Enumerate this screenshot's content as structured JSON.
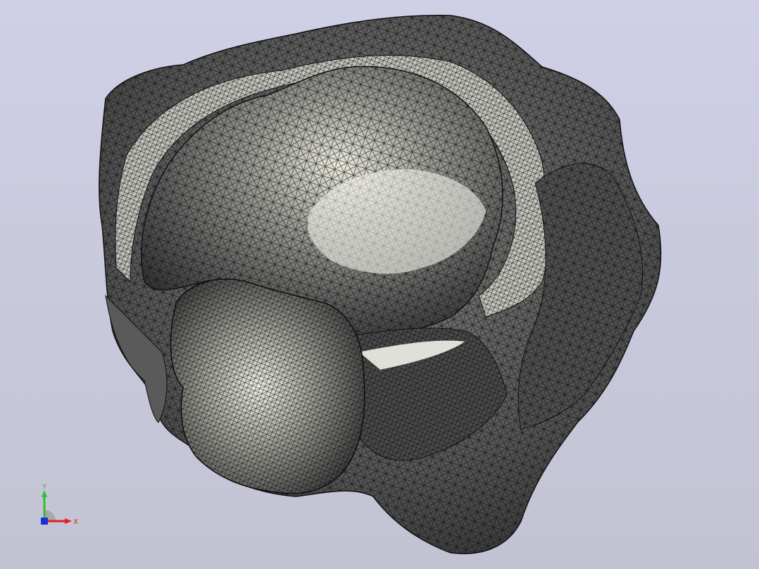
{
  "viewport": {
    "background_top": "#cfd0e6",
    "background_bottom": "#c2c3d2",
    "model": {
      "name": "mesh-model",
      "render_mode": "shaded-with-mesh-edges",
      "surface_color": "#6b6b6b",
      "highlight_color": "#f2f2ea",
      "edge_color": "#111111"
    }
  },
  "triad": {
    "y_label": "Y",
    "x_label": "X",
    "y_color": "#2fbf2f",
    "x_color": "#e02020",
    "z_color": "#1c2fd6"
  }
}
